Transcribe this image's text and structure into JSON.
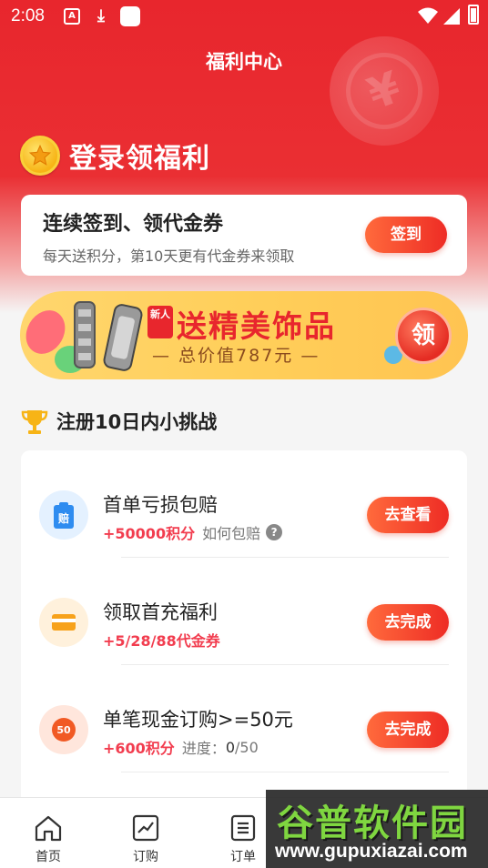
{
  "status_bar": {
    "time": "2:08"
  },
  "header": {
    "title": "福利中心"
  },
  "welfare": {
    "title": "登录领福利",
    "signin_card": {
      "title": "连续签到、领代金券",
      "subtitle": "每天送积分，第10天更有代金券来领取",
      "button_label": "签到"
    }
  },
  "banner": {
    "badge": "新人",
    "main_text": "送精美饰品",
    "sub_text": "— 总价值787元 —",
    "button_label": "领"
  },
  "challenge": {
    "title": "注册10日内小挑战",
    "tasks": [
      {
        "title": "首单亏损包赔",
        "reward": "+50000积分",
        "extra": "如何包赔",
        "button_label": "去查看",
        "icon_text": "赔"
      },
      {
        "title": "领取首充福利",
        "reward": "+5/28/88代金券",
        "extra": "",
        "button_label": "去完成"
      },
      {
        "title": "单笔现金订购>=50元",
        "reward": "+600积分",
        "progress_label": "进度：",
        "progress_value": "0",
        "progress_total": "/50",
        "button_label": "去完成",
        "icon_text": "50"
      }
    ]
  },
  "tabbar": {
    "items": [
      {
        "label": "首页"
      },
      {
        "label": "订购"
      },
      {
        "label": "订单"
      }
    ]
  },
  "watermark": {
    "main": "谷普软件园",
    "url": "www.gupuxiazai.com"
  },
  "colors": {
    "primary": "#e8262d",
    "reward": "#f23d4f",
    "gold": "#ffcf5a"
  }
}
